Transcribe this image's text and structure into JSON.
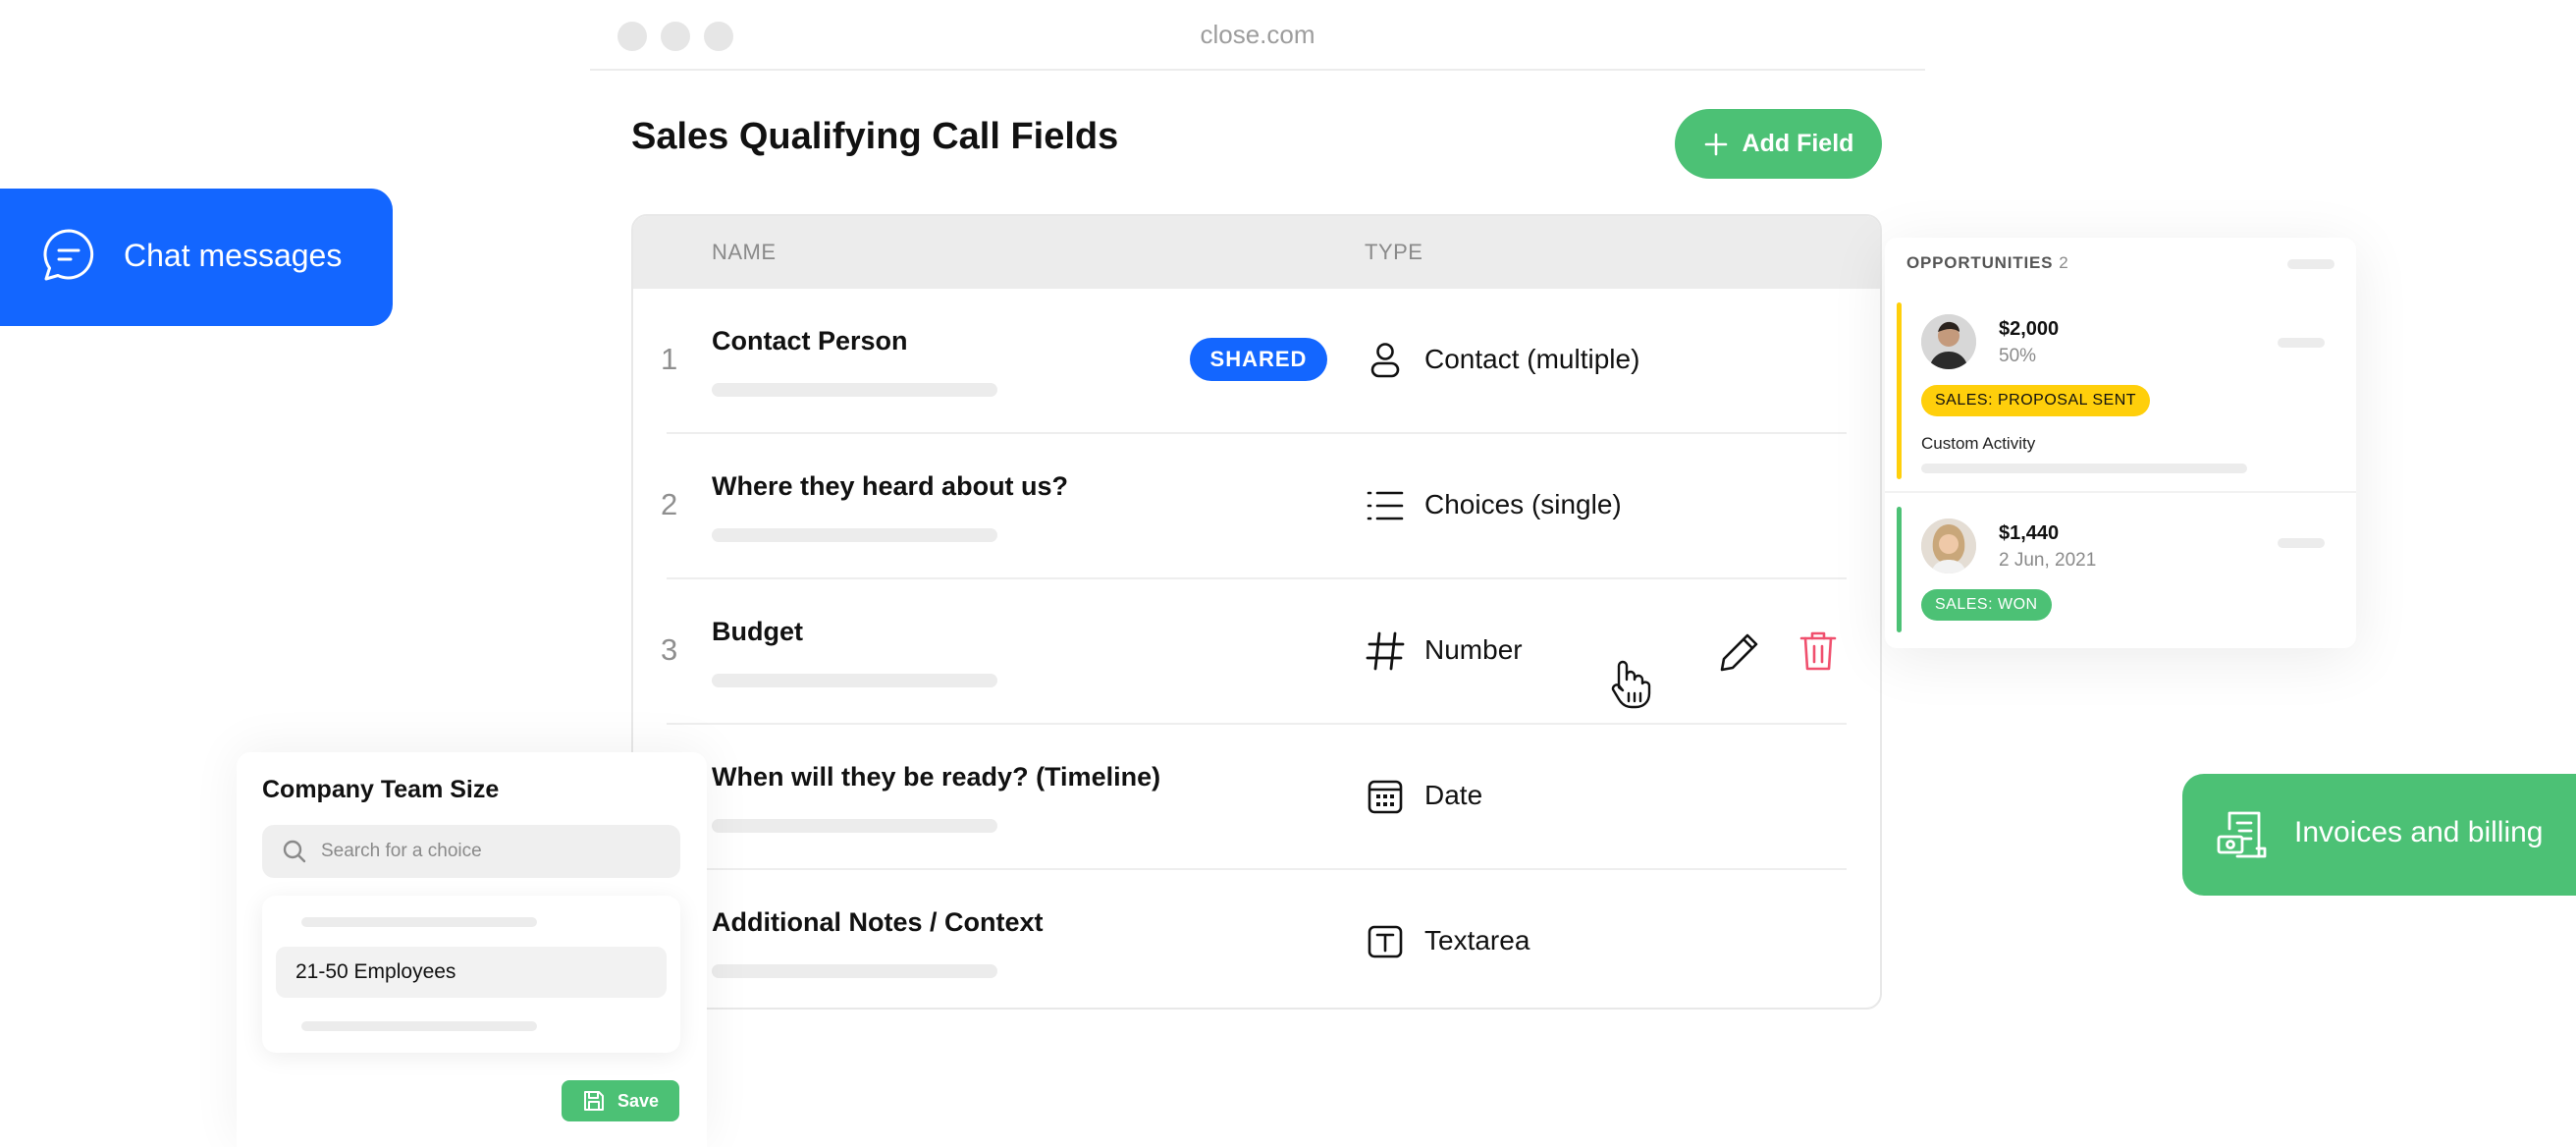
{
  "browser": {
    "url": "close.com"
  },
  "page": {
    "title": "Sales Qualifying Call Fields",
    "add_field_label": "Add Field"
  },
  "table": {
    "columns": {
      "name": "NAME",
      "type": "TYPE"
    },
    "rows": [
      {
        "number": "1",
        "name": "Contact Person",
        "badge": "SHARED",
        "type": "Contact (multiple)",
        "icon": "person-icon"
      },
      {
        "number": "2",
        "name": "Where they heard about us?",
        "badge": "",
        "type": "Choices (single)",
        "icon": "list-icon"
      },
      {
        "number": "3",
        "name": "Budget",
        "badge": "",
        "type": "Number",
        "icon": "hash-icon"
      },
      {
        "number": "",
        "name": "When will they be ready? (Timeline)",
        "badge": "",
        "type": "Date",
        "icon": "calendar-icon"
      },
      {
        "number": "",
        "name": "Additional Notes / Context",
        "badge": "",
        "type": "Textarea",
        "icon": "text-box-icon"
      }
    ]
  },
  "chat_pill": {
    "label": "Chat messages",
    "color": "#1366ff"
  },
  "invoice_pill": {
    "label": "Invoices and billing",
    "color": "#4cc175"
  },
  "opportunities": {
    "header": "OPPORTUNITIES",
    "count": "2",
    "items": [
      {
        "amount": "$2,000",
        "sub": "50%",
        "tag": "SALES: PROPOSAL SENT",
        "tag_color": "#ffcf0b",
        "stripe_color": "#ffcf0b",
        "activity": "Custom Activity"
      },
      {
        "amount": "$1,440",
        "sub": "2 Jun, 2021",
        "tag": "SALES: WON",
        "tag_color": "#4cc175",
        "stripe_color": "#4cc175",
        "activity": ""
      }
    ]
  },
  "team_size": {
    "title": "Company Team Size",
    "search_placeholder": "Search for a choice",
    "selected_option": "21-50 Employees",
    "save_label": "Save"
  },
  "colors": {
    "brand_blue": "#1366ff",
    "brand_green": "#4cc175",
    "danger": "#f0506e"
  }
}
